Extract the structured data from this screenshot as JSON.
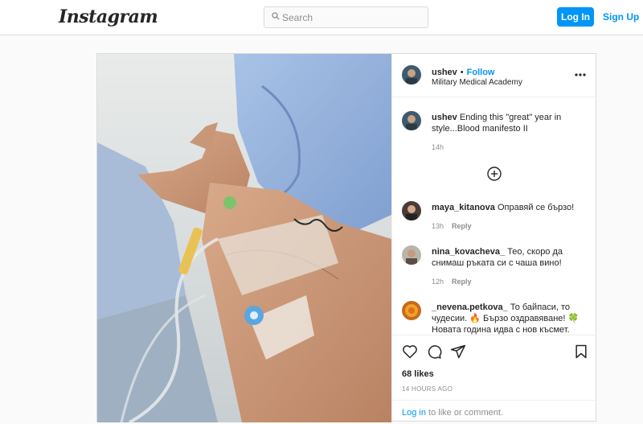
{
  "nav": {
    "logo": "Instagram",
    "search_placeholder": "Search",
    "login_label": "Log In",
    "signup_label": "Sign Up"
  },
  "post": {
    "author": {
      "username": "ushev",
      "follow_label": "Follow",
      "location": "Military Medical Academy"
    },
    "caption": {
      "username": "ushev",
      "text": "Ending this \"great\" year in style...Blood manifesto II",
      "time": "14h"
    },
    "comments": [
      {
        "username": "maya_kitanova",
        "text": "Оправяй се бързо!",
        "time": "13h",
        "reply_label": "Reply"
      },
      {
        "username": "nina_kovacheva_",
        "text": "Тео, скоро да снимаш ръката си с чаша вино!",
        "time": "12h",
        "reply_label": "Reply"
      },
      {
        "username": "_nevena.petkova_",
        "text": "То байпаси, то чудесии. 🔥 Бързо оздравяване! 🍀 Новата година идва с нов късмет.",
        "time": "",
        "reply_label": ""
      }
    ],
    "likes": "68 likes",
    "posted_time": "14 HOURS AGO",
    "login_prompt": {
      "link": "Log in",
      "rest": " to like or comment."
    },
    "icons": {
      "like": "heart-icon",
      "comment": "comment-icon",
      "share": "share-icon",
      "save": "bookmark-icon",
      "more": "more-options-icon",
      "load_more": "plus-circle-icon"
    },
    "colors": {
      "accent": "#0095f6",
      "border": "#dbdbdb",
      "muted": "#8e8e8e"
    }
  }
}
